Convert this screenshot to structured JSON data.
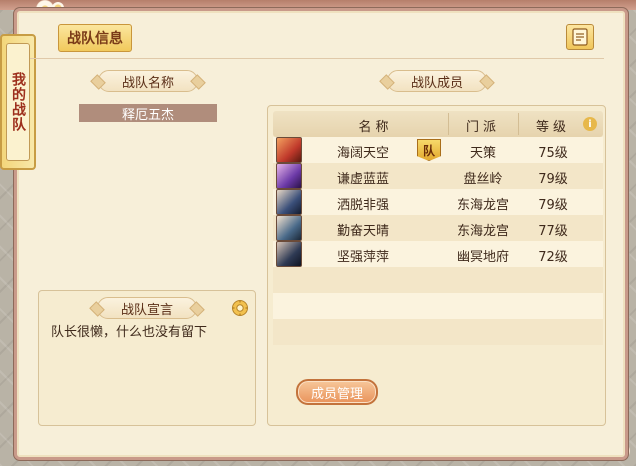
{
  "side_tab": {
    "label": "我的战队"
  },
  "header": {
    "title": "战队信息"
  },
  "left": {
    "team_name_label": "战队名称",
    "team_name": "释厄五杰",
    "declaration_label": "战队宣言",
    "declaration_text": "队长很懒，什么也没有留下"
  },
  "members": {
    "section_label": "战队成员",
    "columns": {
      "name": "名称",
      "sect": "门派",
      "level": "等级"
    },
    "leader_badge": "队",
    "rows": [
      {
        "name": "海阔天空",
        "sect": "天策",
        "level": "75级",
        "avatar_color": "#c0392b"
      },
      {
        "name": "谦虚蓝蓝",
        "sect": "盘丝岭",
        "level": "79级",
        "avatar_color": "#6c3aa8"
      },
      {
        "name": "洒脱非强",
        "sect": "东海龙宫",
        "level": "79级",
        "avatar_color": "#3a4f7a"
      },
      {
        "name": "勤奋天晴",
        "sect": "东海龙宫",
        "level": "77级",
        "avatar_color": "#4a6a8a"
      },
      {
        "name": "坚强萍萍",
        "sect": "幽冥地府",
        "level": "72级",
        "avatar_color": "#2f3b55"
      }
    ],
    "manage_button": "成员管理"
  }
}
